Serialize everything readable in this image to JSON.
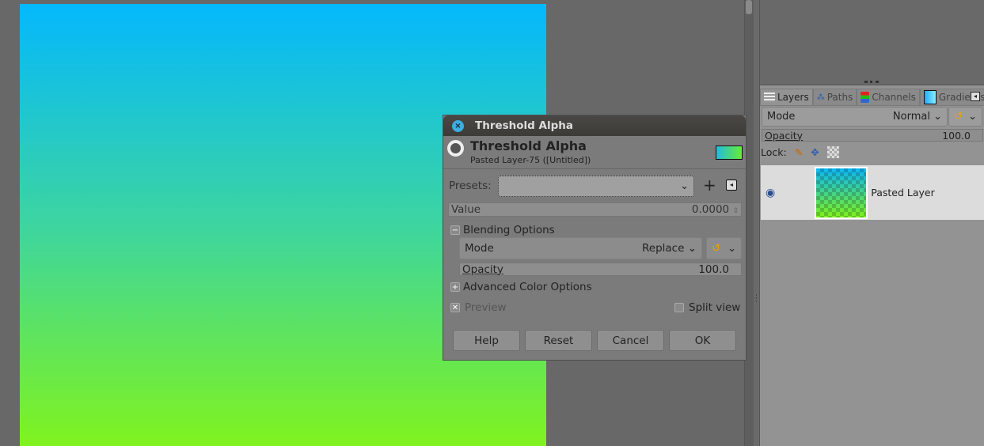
{
  "canvas": {
    "gradient_top": "#04b8fd",
    "gradient_bottom": "#80f31e"
  },
  "dialog": {
    "window_title": "Threshold Alpha",
    "header_title": "Threshold Alpha",
    "header_subtitle": "Pasted Layer-75 ([Untitled])",
    "presets_label": "Presets:",
    "presets_value": "",
    "value_label": "Value",
    "value": "0.0000",
    "blending_options": "Blending Options",
    "mode_label": "Mode",
    "mode_value": "Replace",
    "opacity_label": "Opacity",
    "opacity_value": "100.0",
    "advanced_color_options": "Advanced Color Options",
    "preview_label": "Preview",
    "preview_checked": true,
    "split_view_label": "Split view",
    "split_view_checked": false,
    "buttons": {
      "help": "Help",
      "reset": "Reset",
      "cancel": "Cancel",
      "ok": "OK"
    }
  },
  "layers_panel": {
    "tabs": [
      {
        "label": "Layers"
      },
      {
        "label": "Paths"
      },
      {
        "label": "Channels"
      },
      {
        "label": "Gradients"
      }
    ],
    "mode_label": "Mode",
    "mode_value": "Normal",
    "opacity_label": "Opacity",
    "opacity_value": "100.0",
    "lock_label": "Lock:",
    "layers": [
      {
        "name": "Pasted Layer",
        "visible": true
      }
    ]
  }
}
